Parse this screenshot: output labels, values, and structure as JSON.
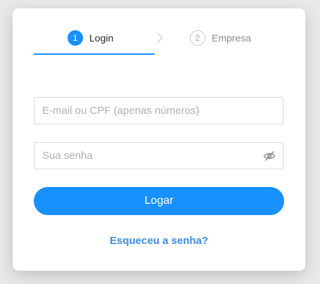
{
  "steps": [
    {
      "number": "1",
      "label": "Login",
      "state": "active"
    },
    {
      "number": "2",
      "label": "Empresa",
      "state": "inactive"
    }
  ],
  "form": {
    "email_placeholder": "E-mail ou CPF (apenas números)",
    "email_value": "",
    "password_placeholder": "Sua senha",
    "password_value": "",
    "password_toggle_icon": "eye-invisible-icon",
    "login_label": "Logar",
    "forgot_label": "Esqueceu a senha?"
  },
  "colors": {
    "primary": "#1890ff",
    "link": "#3a8ee6",
    "border": "#d9d9d9"
  }
}
